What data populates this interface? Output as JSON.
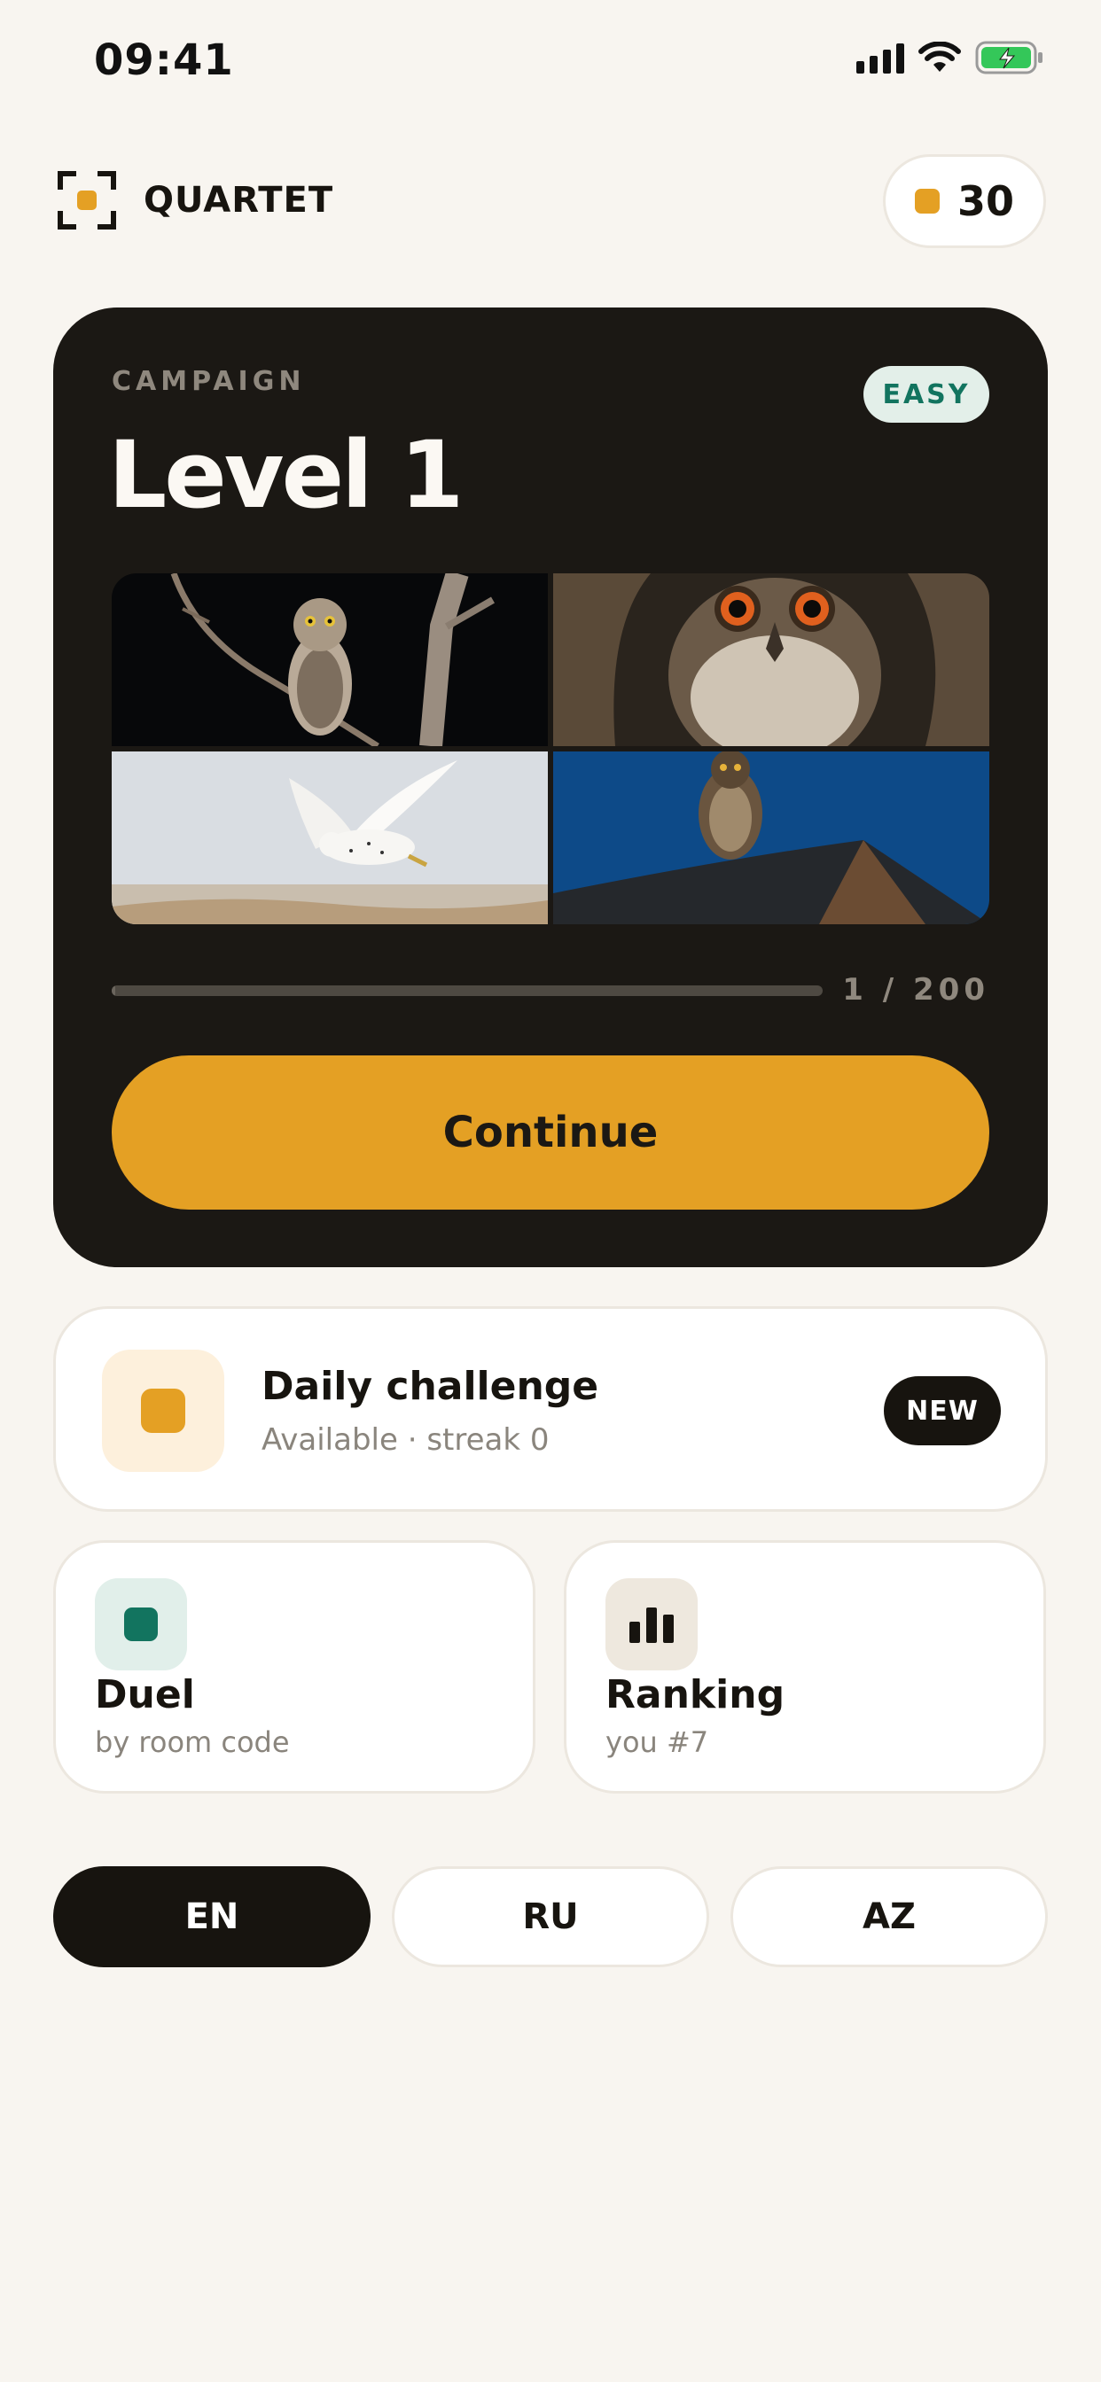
{
  "status_bar": {
    "time": "09:41",
    "icons": [
      "signal-icon",
      "wifi-icon",
      "battery-charging-icon"
    ]
  },
  "header": {
    "app_name": "QUARTET",
    "logo_icon": "viewfinder-icon",
    "coins": "30",
    "coin_icon": "coin-icon"
  },
  "campaign": {
    "eyebrow": "CAMPAIGN",
    "difficulty": "EASY",
    "level_title": "Level 1",
    "photos": [
      {
        "subject": "owl perched on a bare branch at night",
        "icon": "owl-branch-photo"
      },
      {
        "subject": "close-up owl face with orange eyes",
        "icon": "owl-face-photo"
      },
      {
        "subject": "white owl flying over snow",
        "icon": "snowy-owl-photo"
      },
      {
        "subject": "owl on a rooftop at dusk",
        "icon": "owl-roof-photo"
      }
    ],
    "progress_current": 1,
    "progress_total": 200,
    "progress_label": "1 / 200",
    "cta_label": "Continue"
  },
  "daily": {
    "title": "Daily challenge",
    "subtitle": "Available · streak 0",
    "badge": "NEW"
  },
  "modes": {
    "duel": {
      "title": "Duel",
      "subtitle": "by room code",
      "icon": "duel-icon"
    },
    "ranking": {
      "title": "Ranking",
      "subtitle": "you #7",
      "icon": "bar-chart-icon"
    }
  },
  "languages": {
    "options": [
      "EN",
      "RU",
      "AZ"
    ],
    "selected": "EN"
  },
  "colors": {
    "background": "#f8f5f0",
    "card_dark": "#1b1814",
    "accent": "#e4a024",
    "teal": "#12745f",
    "text": "#17140f",
    "muted": "#8a857d"
  }
}
